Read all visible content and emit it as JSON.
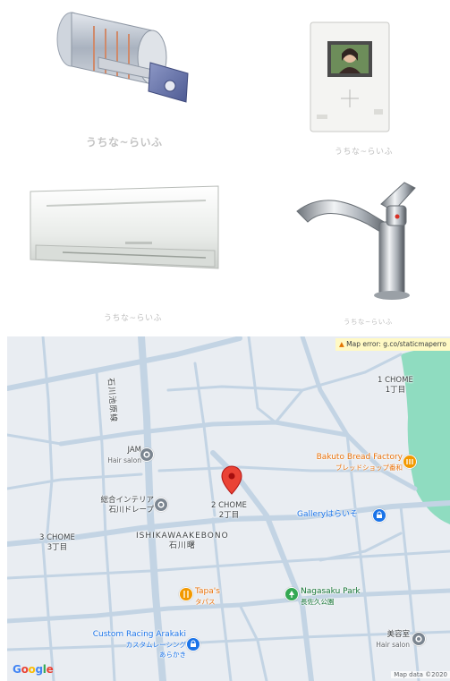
{
  "photos": {
    "lock": {
      "watermark": "うちな~らいふ"
    },
    "intercom": {
      "watermark": "うちな~らいふ"
    },
    "aircon": {
      "watermark": "うちな~らいふ"
    },
    "faucet": {
      "watermark": "うちな~らいふ"
    }
  },
  "map": {
    "error_text": "Map error: g.co/staticmaperro",
    "road_label": "石川池原線",
    "places": {
      "chome1": {
        "line1": "1 CHOME",
        "line2": "1丁目"
      },
      "jam": {
        "name": "JAM",
        "category": "Hair salon"
      },
      "bakuto": {
        "name": "Bakuto Bread Factory",
        "sub": "ブレッドショップ番和"
      },
      "sogo": {
        "name": "総合インテリア",
        "sub": "石川ドレープ"
      },
      "chome2": {
        "line1": "2 CHOME",
        "line2": "2丁目"
      },
      "gallery": {
        "name": "Galleryはらいそ"
      },
      "chome3": {
        "line1": "3 CHOME",
        "line2": "3丁目"
      },
      "district": {
        "line1": "ISHIKAWAAKEBONO",
        "line2": "石川曙"
      },
      "tapas": {
        "name": "Tapa's",
        "sub": "タパス"
      },
      "nagasaku": {
        "name": "Nagasaku Park",
        "sub": "長佐久公園"
      },
      "custom": {
        "name": "Custom Racing Arakaki",
        "sub1": "カスタムレーシング",
        "sub2": "あらかき"
      },
      "biyoshitsu": {
        "name": "美容室",
        "category": "Hair salon"
      }
    },
    "logo": "Google",
    "attribution": "Map data ©2020"
  },
  "colors": {
    "map_bg": "#e9edf2",
    "road": "#c3d4e4",
    "water": "#8fdcc0",
    "pin": "#ea4335",
    "poi_gray": "#7b8590",
    "poi_orange": "#f29900",
    "poi_blue": "#1a73e8",
    "poi_green": "#34a853"
  }
}
